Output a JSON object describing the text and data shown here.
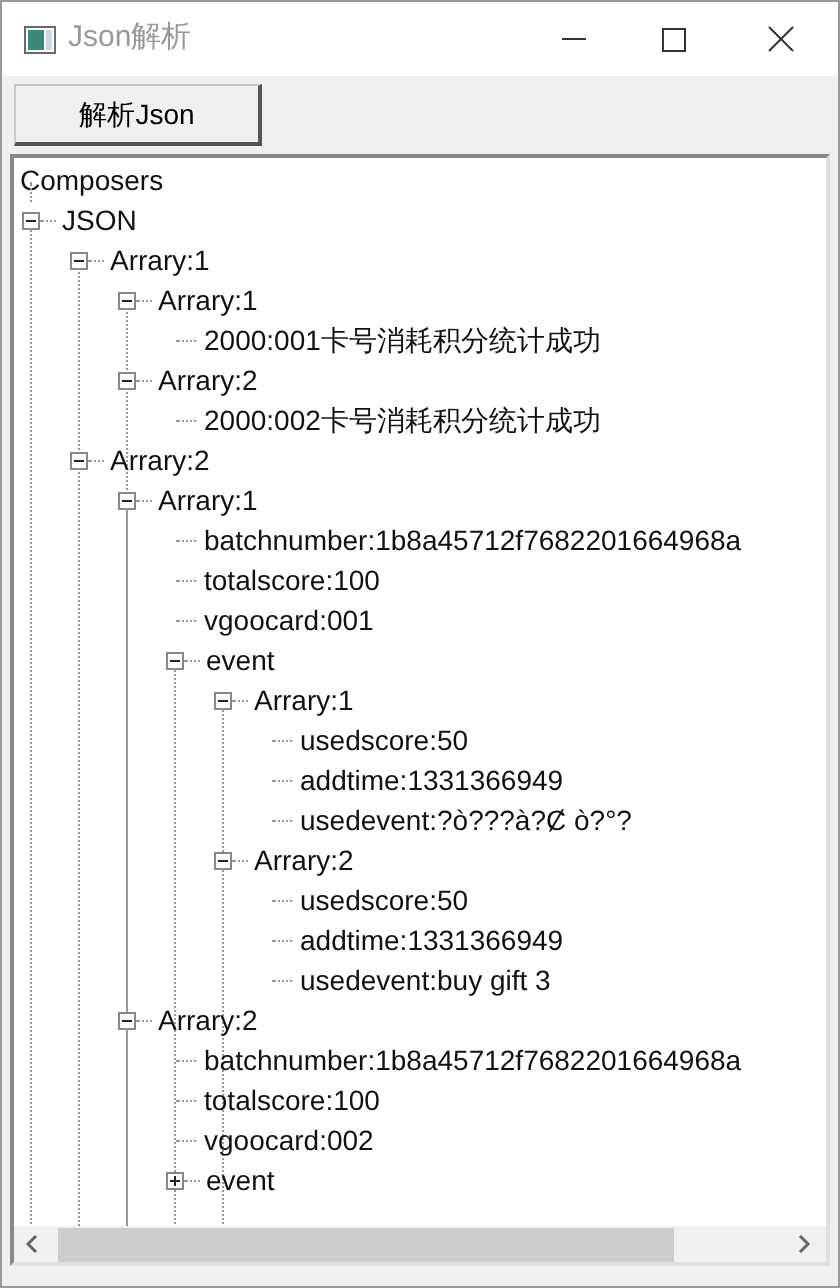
{
  "window": {
    "title": "Json解析"
  },
  "toolbar": {
    "button": "解析Json"
  },
  "tree": {
    "header": "Composers",
    "nodes": [
      {
        "label": "JSON",
        "expanded": true,
        "children": [
          {
            "label": "Arrary:1",
            "expanded": true,
            "children": [
              {
                "label": "Arrary:1",
                "expanded": true,
                "children": [
                  {
                    "label": "2000:001卡号消耗积分统计成功"
                  }
                ]
              },
              {
                "label": "Arrary:2",
                "expanded": true,
                "children": [
                  {
                    "label": "2000:002卡号消耗积分统计成功"
                  }
                ]
              }
            ]
          },
          {
            "label": "Arrary:2",
            "expanded": true,
            "children": [
              {
                "label": "Arrary:1",
                "expanded": true,
                "children": [
                  {
                    "label": "batchnumber:1b8a45712f7682201664968a"
                  },
                  {
                    "label": "totalscore:100"
                  },
                  {
                    "label": "vgoocard:001"
                  },
                  {
                    "label": "event",
                    "expanded": true,
                    "children": [
                      {
                        "label": "Arrary:1",
                        "expanded": true,
                        "children": [
                          {
                            "label": "usedscore:50"
                          },
                          {
                            "label": "addtime:1331366949"
                          },
                          {
                            "label": "usedevent:?ò???à?Ȼ ò?°?"
                          }
                        ]
                      },
                      {
                        "label": "Arrary:2",
                        "expanded": true,
                        "children": [
                          {
                            "label": "usedscore:50"
                          },
                          {
                            "label": "addtime:1331366949"
                          },
                          {
                            "label": "usedevent:buy gift 3"
                          }
                        ]
                      }
                    ]
                  }
                ]
              },
              {
                "label": "Arrary:2",
                "expanded": true,
                "children": [
                  {
                    "label": "batchnumber:1b8a45712f7682201664968a"
                  },
                  {
                    "label": "totalscore:100"
                  },
                  {
                    "label": "vgoocard:002"
                  },
                  {
                    "label": "event",
                    "expanded": false
                  }
                ]
              }
            ]
          }
        ]
      }
    ]
  }
}
